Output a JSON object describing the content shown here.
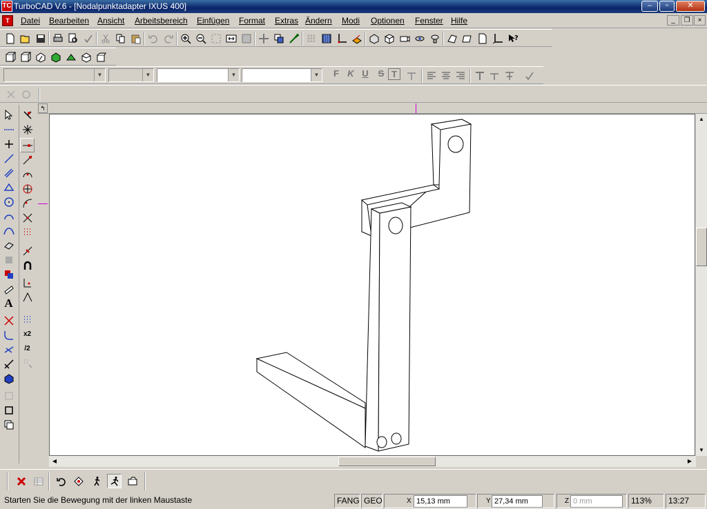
{
  "window": {
    "title": "TurboCAD V.6 - [Nodalpunktadapter IXUS 400]",
    "app_icon": "TC",
    "minimize": "–",
    "maximize": "▫",
    "close": "✕"
  },
  "menu": {
    "items": [
      "Datei",
      "Bearbeiten",
      "Ansicht",
      "Arbeitsbereich",
      "Einfügen",
      "Format",
      "Extras",
      "Ändern",
      "Modi",
      "Optionen",
      "Fenster",
      "Hilfe"
    ]
  },
  "mdi": {
    "minimize": "_",
    "restore": "❐",
    "close": "×"
  },
  "format_bar": {
    "bold": "F",
    "italic": "K",
    "underline": "U",
    "strike": "S",
    "highlight": "T"
  },
  "statusbar": {
    "message": "Starten Sie die Bewegung mit der linken Maustaste",
    "fang": "FANG",
    "geo": "GEO",
    "x_label": "X",
    "x_value": "15,13 mm",
    "y_label": "Y",
    "y_value": "27,34 mm",
    "z_label": "Z",
    "z_placeholder": "0 mm",
    "zoom": "113%",
    "time": "13:27"
  },
  "left_toolbar": {
    "text_tool": "A",
    "x2": "x2",
    "half": "/2"
  },
  "colors": {
    "titlebar": "#0a246a",
    "chrome": "#d4d0c8",
    "canvas": "#ffffff",
    "accent_magenta": "#cc00cc",
    "delete_red": "#cc0000"
  }
}
